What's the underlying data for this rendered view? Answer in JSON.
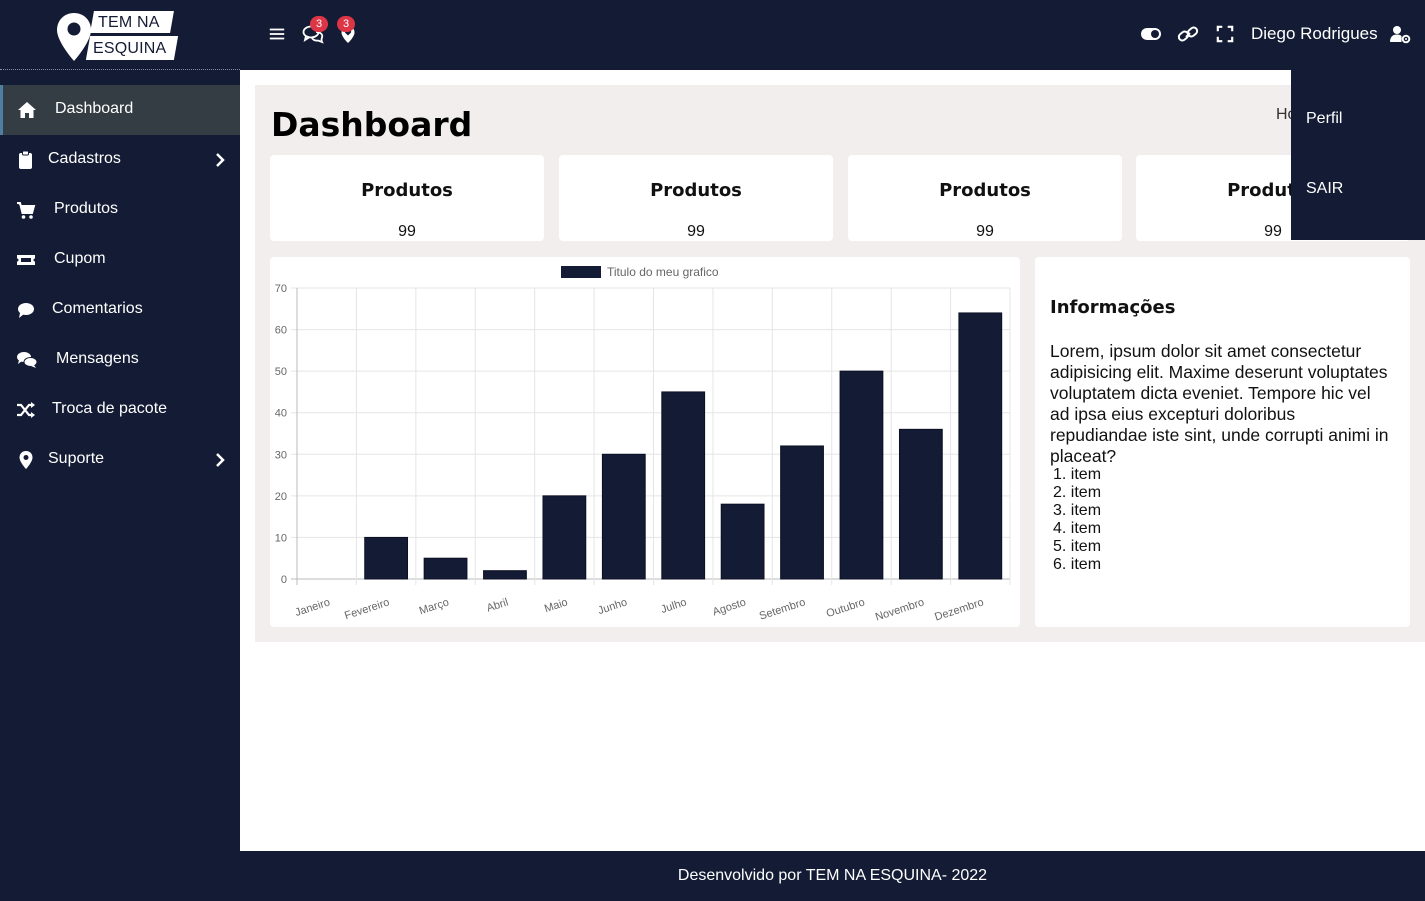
{
  "brand": {
    "line1": "TEM NA",
    "line2": "ESQUINA"
  },
  "sidebar": {
    "items": [
      {
        "label": "Dashboard",
        "icon": "home-icon",
        "active": true
      },
      {
        "label": "Cadastros",
        "icon": "clipboard-icon",
        "has_children": true
      },
      {
        "label": "Produtos",
        "icon": "cart-icon"
      },
      {
        "label": "Cupom",
        "icon": "ticket-icon"
      },
      {
        "label": "Comentarios",
        "icon": "comment-icon"
      },
      {
        "label": "Mensagens",
        "icon": "comments-icon"
      },
      {
        "label": "Troca de pacote",
        "icon": "shuffle-icon"
      },
      {
        "label": "Suporte",
        "icon": "map-marker-icon",
        "has_children": true
      }
    ]
  },
  "topbar": {
    "messages_badge": "3",
    "notifications_badge": "3",
    "user_name": "Diego Rodrigues"
  },
  "dropdown": {
    "items": [
      "Perfil",
      "SAIR"
    ]
  },
  "page": {
    "title": "Dashboard",
    "breadcrumb": "Home"
  },
  "cards": [
    {
      "title": "Produtos",
      "value": "99"
    },
    {
      "title": "Produtos",
      "value": "99"
    },
    {
      "title": "Produtos",
      "value": "99"
    },
    {
      "title": "Produtos",
      "value": "99"
    }
  ],
  "chart_data": {
    "type": "bar",
    "categories": [
      "Janeiro",
      "Fevereiro",
      "Março",
      "Abril",
      "Maio",
      "Junho",
      "Julho",
      "Agosto",
      "Setembro",
      "Outubro",
      "Novembro",
      "Dezembro"
    ],
    "series": [
      {
        "name": "Titulo do meu grafico",
        "values": [
          0,
          10,
          5,
          2,
          20,
          30,
          45,
          18,
          32,
          50,
          36,
          64
        ]
      }
    ],
    "yticks": [
      0,
      10,
      20,
      30,
      40,
      50,
      60,
      70
    ],
    "ylim": [
      0,
      70
    ],
    "grid": true,
    "legend": "top-center"
  },
  "info": {
    "title": "Informações",
    "text": "Lorem, ipsum dolor sit amet consectetur adipisicing elit. Maxime deserunt voluptates voluptatem dicta eveniet. Tempore hic vel ad ipsa eius excepturi doloribus repudiandae iste sint, unde corrupti animi in placeat?",
    "items": [
      "1. item",
      "2. item",
      "3. item",
      "4. item",
      "5. item",
      "6. item"
    ]
  },
  "footer": {
    "text": "Desenvolvido por TEM NA ESQUINA- 2022"
  },
  "colors": {
    "navy": "#141b34",
    "content_bg": "#f1eeed",
    "badge": "#dc3545",
    "active_item": "#343d43"
  }
}
